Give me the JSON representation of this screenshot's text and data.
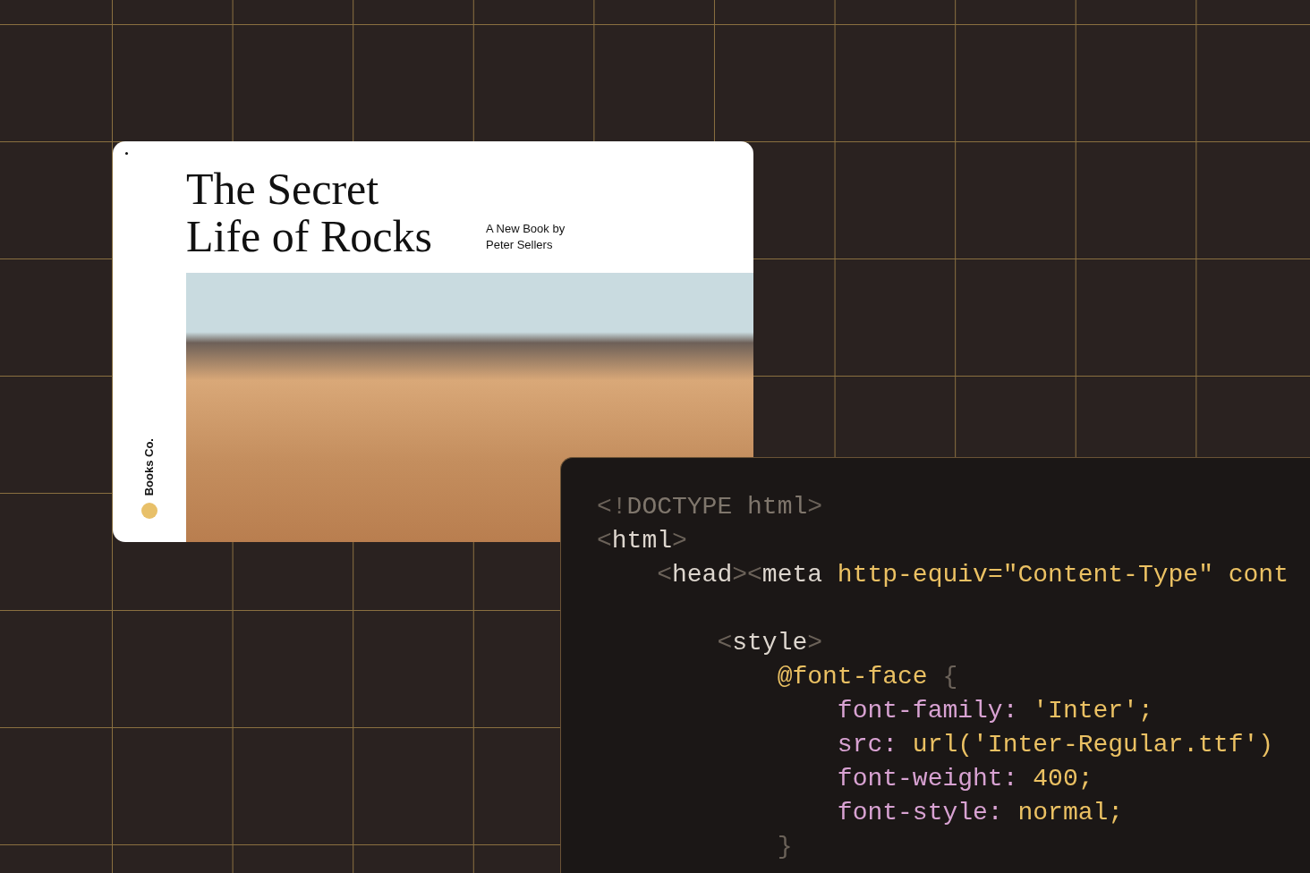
{
  "book_page": {
    "brand": "Books Co.",
    "title_lines": [
      "The Secret",
      "Life of Rocks"
    ],
    "byline_lines": [
      "A New Book by",
      "Peter Sellers"
    ]
  },
  "code_editor": {
    "lines": [
      {
        "tokens": [
          {
            "kind": "punct",
            "text": "<!"
          },
          {
            "kind": "doctype",
            "text": "DOCTYPE html"
          },
          {
            "kind": "punct",
            "text": ">"
          }
        ]
      },
      {
        "tokens": [
          {
            "kind": "punct",
            "text": "<"
          },
          {
            "kind": "tag",
            "text": "html"
          },
          {
            "kind": "punct",
            "text": ">"
          }
        ],
        "children": [
          {
            "tokens": [
              {
                "kind": "punct",
                "text": "<"
              },
              {
                "kind": "tag",
                "text": "head"
              },
              {
                "kind": "punct",
                "text": "><"
              },
              {
                "kind": "tag",
                "text": "meta "
              },
              {
                "kind": "attr",
                "text": "http-equiv=\"Content-Type\" cont"
              }
            ],
            "children": [
              {
                "blank_before": true,
                "tokens": [
                  {
                    "kind": "punct",
                    "text": "<"
                  },
                  {
                    "kind": "tag",
                    "text": "style"
                  },
                  {
                    "kind": "punct",
                    "text": ">"
                  }
                ],
                "children": [
                  {
                    "tokens": [
                      {
                        "kind": "attr",
                        "text": "@font-face "
                      },
                      {
                        "kind": "punct",
                        "text": "{"
                      }
                    ],
                    "children": [
                      {
                        "tokens": [
                          {
                            "kind": "prop",
                            "text": "font-family: "
                          },
                          {
                            "kind": "attr",
                            "text": "'Inter';"
                          }
                        ]
                      },
                      {
                        "tokens": [
                          {
                            "kind": "prop",
                            "text": "src: "
                          },
                          {
                            "kind": "attr",
                            "text": "url('Inter-Regular.ttf')"
                          }
                        ]
                      },
                      {
                        "tokens": [
                          {
                            "kind": "prop",
                            "text": "font-weight: "
                          },
                          {
                            "kind": "attr",
                            "text": "400;"
                          }
                        ]
                      },
                      {
                        "tokens": [
                          {
                            "kind": "prop",
                            "text": "font-style: "
                          },
                          {
                            "kind": "attr",
                            "text": "normal;"
                          }
                        ]
                      }
                    ]
                  },
                  {
                    "tokens": [
                      {
                        "kind": "punct",
                        "text": "}"
                      }
                    ]
                  }
                ]
              }
            ]
          }
        ]
      }
    ]
  }
}
